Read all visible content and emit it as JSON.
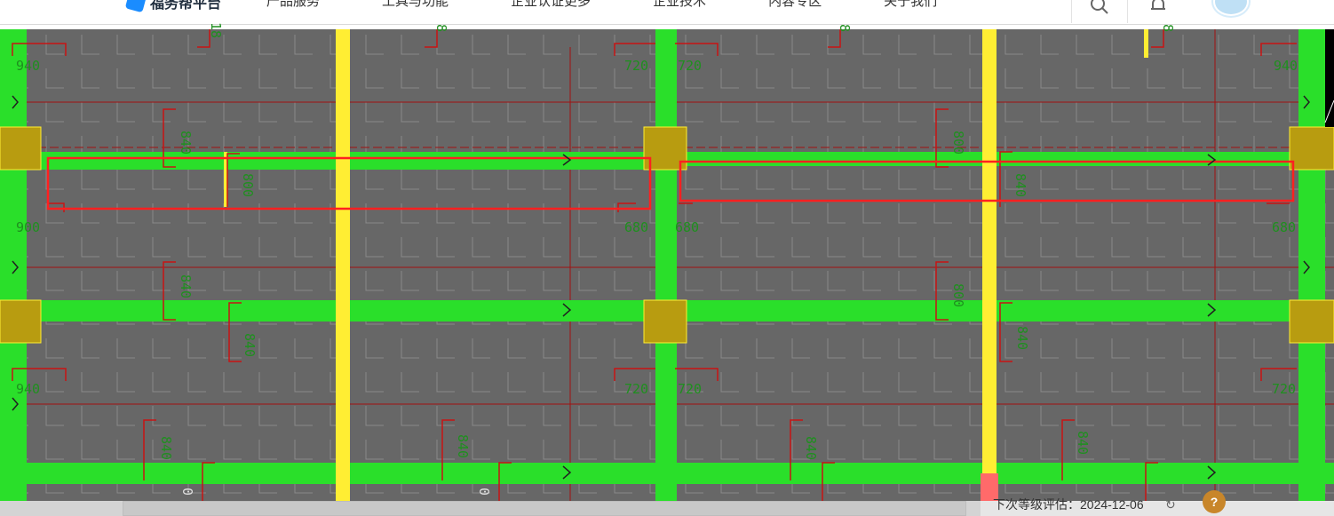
{
  "app": {
    "logo_text": "福务帮平台",
    "nav": [
      "产品服务",
      "工具与功能",
      "企业认证更多",
      "企业技术",
      "内容专区",
      "关于我们"
    ]
  },
  "header_icons": {
    "search": "search-icon",
    "notifications": "bell-icon",
    "avatar": "avatar"
  },
  "drawing": {
    "colors": {
      "background": "#676767",
      "beam": "#2adf2a",
      "column": "#ffee33",
      "wall_box": "#b89c10",
      "dim_line": "#c81414",
      "selection": "#ff2020",
      "text": "#1f8f1f"
    },
    "dimension_labels": [
      {
        "text": "940"
      },
      {
        "text": "720"
      },
      {
        "text": "720"
      },
      {
        "text": "940"
      },
      {
        "text": "900"
      },
      {
        "text": "680"
      },
      {
        "text": "680"
      },
      {
        "text": "680"
      },
      {
        "text": "940"
      },
      {
        "text": "720"
      },
      {
        "text": "720"
      },
      {
        "text": "720"
      }
    ],
    "beam_labels": [
      {
        "text": "840"
      },
      {
        "text": "800"
      },
      {
        "text": "800"
      },
      {
        "text": "840"
      },
      {
        "text": "840"
      },
      {
        "text": "800"
      },
      {
        "text": "840"
      },
      {
        "text": "840"
      },
      {
        "text": "840"
      },
      {
        "text": "840"
      },
      {
        "text": "840"
      },
      {
        "text": "840"
      }
    ],
    "partial_labels": [
      {
        "text": "0"
      },
      {
        "text": "0"
      }
    ],
    "top_partial": [
      {
        "text": "18"
      },
      {
        "text": "8"
      },
      {
        "text": "8"
      },
      {
        "text": "8"
      }
    ]
  },
  "statusbar": {
    "text": "下次等级评估：2024-12-06",
    "refresh_icon": "refresh-icon",
    "help_label": "?"
  }
}
